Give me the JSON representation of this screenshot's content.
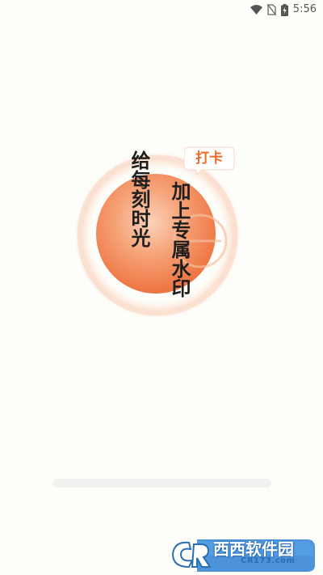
{
  "status_bar": {
    "time": "5:56",
    "icons": [
      "wifi-icon",
      "no-sim-icon",
      "battery-charging-icon"
    ]
  },
  "splash": {
    "slogan_left": "给每刻时光",
    "slogan_right": "加上专属水印",
    "badge": "打卡",
    "logo": "orange-orb-logo",
    "colors": {
      "accent": "#ef6a27",
      "orb_light": "#fbd9c3",
      "orb_dark": "#f08450",
      "text": "#1e1e1e"
    }
  },
  "loading": {
    "progress": 0
  },
  "watermark": {
    "brand": "西西软件园",
    "site": "CR173.com",
    "logo": "cr-logo-icon"
  }
}
